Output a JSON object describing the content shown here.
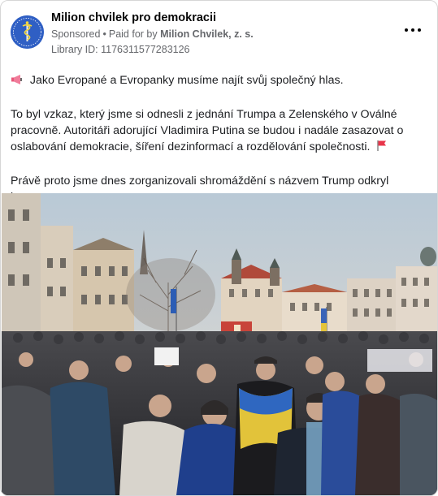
{
  "post": {
    "page_name": "Milion chvilek pro demokracii",
    "sponsored": "Sponsored",
    "separator": "•",
    "paid_for_prefix": "Paid for by",
    "paid_for_by": "Milion Chvilek, z. s.",
    "library_id": "Library ID: 1176311577283126",
    "more_icon": "ellipsis-icon",
    "avatar_icon": "caduceus-logo",
    "paragraph1": "Jako Evropané a Evropanky musíme najít svůj společný hlas.",
    "paragraph1_icon": "megaphone-icon",
    "paragraph2": "To byl vzkaz, který jsme si odnesli z jednání Trumpa a Zelenského v Oválné pracovně. Autoritáři adorující Vladimira Putina se budou i nadále zasazovat o oslabování demokracie, šíření dezinformací a rozdělování společnosti.",
    "paragraph2_icon": "red-flag-icon",
    "paragraph3": "Právě proto jsme dnes zorganizovali shromáždění s názvem Trump odkryl karty:..."
  },
  "colors": {
    "avatar_bg": "#2f5fc4",
    "secondary_text": "#65676b"
  }
}
